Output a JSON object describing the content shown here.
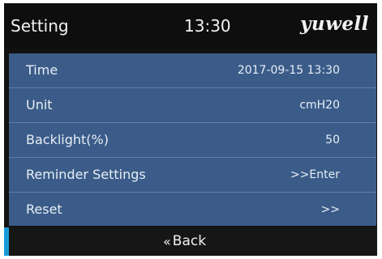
{
  "header": {
    "title": "Setting",
    "time": "13:30",
    "brand": "yuwell"
  },
  "menu": {
    "items": [
      {
        "label": "Time",
        "value": "2017-09-15 13:30"
      },
      {
        "label": "Unit",
        "value": "cmH20"
      },
      {
        "label": "Backlight(%)",
        "value": "50"
      },
      {
        "label": "Reminder Settings",
        "value": ">>Enter"
      },
      {
        "label": "Reset",
        "value": ">>"
      }
    ]
  },
  "footer": {
    "back_label": "Back",
    "back_icon": "double-chevron-left-icon",
    "accent_color": "#1a9bd8"
  },
  "colors": {
    "menu_bg": "#3b5c88",
    "header_bg": "#0e0e0e",
    "footer_bg": "#161616"
  }
}
